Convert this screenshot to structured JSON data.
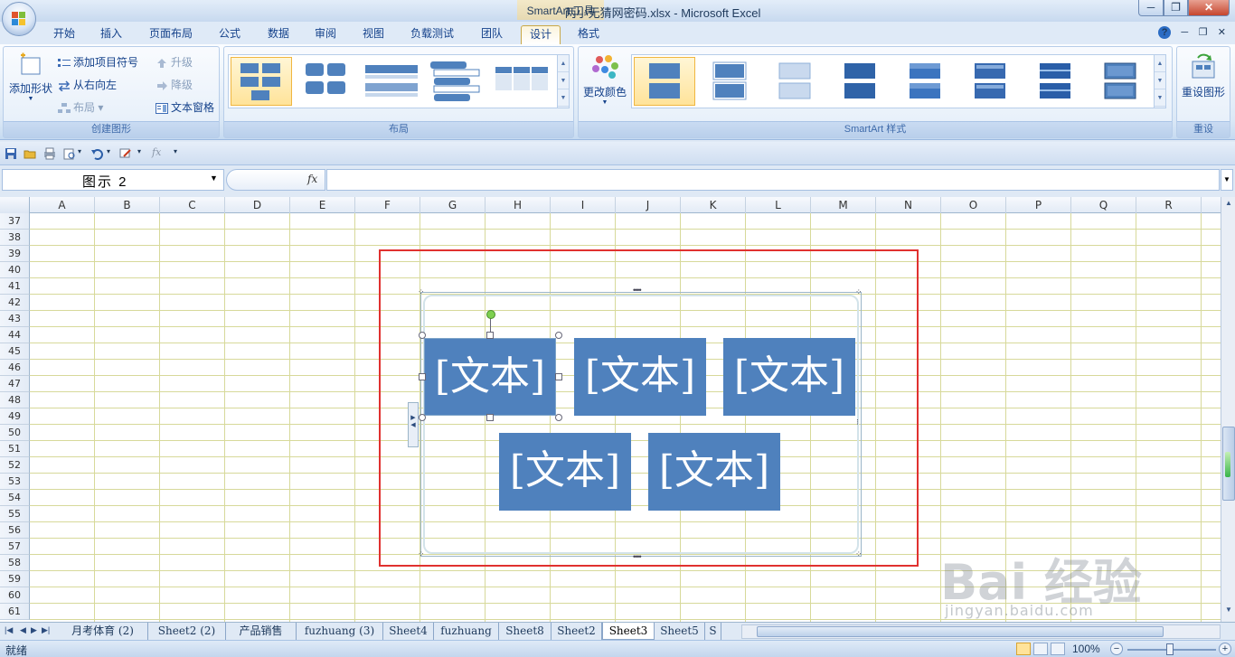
{
  "window": {
    "title": "两小无猜网密码.xlsx - Microsoft Excel",
    "context_title": "SmartArt 工具",
    "min": "─",
    "max": "❐",
    "close": "✕"
  },
  "tabs": [
    {
      "label": "开始"
    },
    {
      "label": "插入"
    },
    {
      "label": "页面布局"
    },
    {
      "label": "公式"
    },
    {
      "label": "数据"
    },
    {
      "label": "审阅"
    },
    {
      "label": "视图"
    },
    {
      "label": "负载测试"
    },
    {
      "label": "团队"
    },
    {
      "label": "设计"
    },
    {
      "label": "格式"
    }
  ],
  "ribbon": {
    "create_graphic": {
      "label": "创建图形",
      "add_shape": "添加形状",
      "add_bullet": "添加项目符号",
      "rtl": "从右向左",
      "layout": "布局",
      "promote": "升级",
      "demote": "降级",
      "text_pane": "文本窗格"
    },
    "layouts": {
      "label": "布局"
    },
    "styles": {
      "label": "SmartArt 样式",
      "change_colors": "更改颜色"
    },
    "reset": {
      "label": "重设",
      "reset_graphic": "重设图形"
    }
  },
  "formula_bar": {
    "name_box": "图示 2",
    "fx": "fx",
    "value": ""
  },
  "columns": [
    "A",
    "B",
    "C",
    "D",
    "E",
    "F",
    "G",
    "H",
    "I",
    "J",
    "K",
    "L",
    "M",
    "N",
    "O",
    "P",
    "Q",
    "R"
  ],
  "rows": [
    "37",
    "38",
    "39",
    "40",
    "41",
    "42",
    "43",
    "44",
    "45",
    "46",
    "47",
    "48",
    "49",
    "50",
    "51",
    "52",
    "53",
    "54",
    "55",
    "56",
    "57",
    "58",
    "59",
    "60",
    "61"
  ],
  "smartart": {
    "nodes": [
      "[文本]",
      "[文本]",
      "[文本]",
      "[文本]",
      "[文本]"
    ],
    "fill_color": "#4f81bd",
    "highlight_color": "#e0312f"
  },
  "sheets": [
    "月考体育 (2)",
    "Sheet2 (2)",
    "产品销售",
    "fuzhuang (3)",
    "Sheet4",
    "fuzhuang",
    "Sheet8",
    "Sheet2",
    "Sheet3",
    "Sheet5",
    "S"
  ],
  "active_sheet": "Sheet3",
  "status": {
    "ready": "就绪",
    "zoom": "100%",
    "zoom_minus": "−",
    "zoom_plus": "+"
  },
  "watermark": {
    "main": "Bai 经验",
    "sub": "jingyan.baidu.com"
  }
}
